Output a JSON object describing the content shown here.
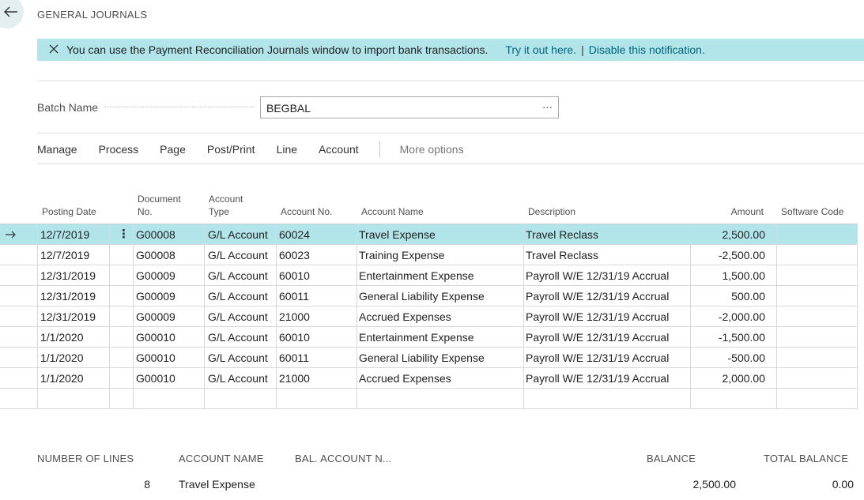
{
  "page": {
    "title": "GENERAL JOURNALS"
  },
  "notification": {
    "text": "You can use the Payment Reconciliation Journals window to import bank transactions.",
    "link_try": "Try it out here.",
    "separator": "|",
    "link_disable": "Disable this notification."
  },
  "batch": {
    "label": "Batch Name",
    "value": "BEGBAL",
    "lookup": "···"
  },
  "actions": [
    "Manage",
    "Process",
    "Page",
    "Post/Print",
    "Line",
    "Account"
  ],
  "more_options": "More options",
  "columns": {
    "posting_date": "Posting Date",
    "document_no_1": "Document",
    "document_no_2": "No.",
    "account_type_1": "Account",
    "account_type_2": "Type",
    "account_no": "Account No.",
    "account_name": "Account Name",
    "description": "Description",
    "amount": "Amount",
    "software_code": "Software Code"
  },
  "rows": [
    {
      "posting_date": "12/7/2019",
      "document_no": "G00008",
      "account_type": "G/L Account",
      "account_no": "60024",
      "account_name": "Travel Expense",
      "description": "Travel Reclass",
      "amount": "2,500.00",
      "software_code": ""
    },
    {
      "posting_date": "12/7/2019",
      "document_no": "G00008",
      "account_type": "G/L Account",
      "account_no": "60023",
      "account_name": "Training Expense",
      "description": "Travel Reclass",
      "amount": "-2,500.00",
      "software_code": ""
    },
    {
      "posting_date": "12/31/2019",
      "document_no": "G00009",
      "account_type": "G/L Account",
      "account_no": "60010",
      "account_name": "Entertainment Expense",
      "description": "Payroll W/E 12/31/19 Accrual",
      "amount": "1,500.00",
      "software_code": ""
    },
    {
      "posting_date": "12/31/2019",
      "document_no": "G00009",
      "account_type": "G/L Account",
      "account_no": "60011",
      "account_name": "General Liability Expense",
      "description": "Payroll W/E 12/31/19 Accrual",
      "amount": "500.00",
      "software_code": ""
    },
    {
      "posting_date": "12/31/2019",
      "document_no": "G00009",
      "account_type": "G/L Account",
      "account_no": "21000",
      "account_name": "Accrued Expenses",
      "description": "Payroll W/E 12/31/19 Accrual",
      "amount": "-2,000.00",
      "software_code": ""
    },
    {
      "posting_date": "1/1/2020",
      "document_no": "G00010",
      "account_type": "G/L Account",
      "account_no": "60010",
      "account_name": "Entertainment Expense",
      "description": "Payroll W/E 12/31/19 Accrual",
      "amount": "-1,500.00",
      "software_code": ""
    },
    {
      "posting_date": "1/1/2020",
      "document_no": "G00010",
      "account_type": "G/L Account",
      "account_no": "60011",
      "account_name": "General Liability Expense",
      "description": "Payroll W/E 12/31/19 Accrual",
      "amount": "-500.00",
      "software_code": ""
    },
    {
      "posting_date": "1/1/2020",
      "document_no": "G00010",
      "account_type": "G/L Account",
      "account_no": "21000",
      "account_name": "Accrued Expenses",
      "description": "Payroll W/E 12/31/19 Accrual",
      "amount": "2,000.00",
      "software_code": ""
    }
  ],
  "footer": {
    "number_of_lines_label": "NUMBER OF LINES",
    "account_name_label": "ACCOUNT NAME",
    "bal_account_label": "BAL. ACCOUNT N...",
    "balance_label": "BALANCE",
    "total_balance_label": "TOTAL BALANCE",
    "number_of_lines": "8",
    "account_name": "Travel Expense",
    "balance": "2,500.00",
    "total_balance": "0.00"
  },
  "colors": {
    "accent": "#b2e5ea",
    "link": "#00647a"
  },
  "icons": {
    "back": "arrow-left-icon",
    "close": "close-icon",
    "row_selector": "arrow-right-icon",
    "row_menu": "vertical-ellipsis-icon"
  }
}
